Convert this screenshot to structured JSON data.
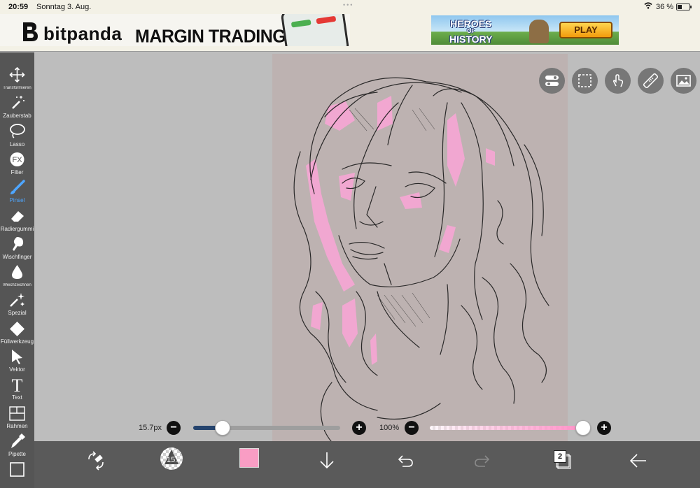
{
  "status_bar": {
    "time": "20:59",
    "date": "Sonntag 3. Aug.",
    "battery": "36 %",
    "battery_level": 0.36
  },
  "ads": {
    "left": {
      "brand": "bitpanda",
      "slogan": "MARGIN TRADING"
    },
    "right": {
      "title_line1": "HEROES",
      "title_of": "OF",
      "title_line2": "HISTORY",
      "button": "PLAY"
    }
  },
  "toolbar": {
    "tools": [
      {
        "label": "Transformieren",
        "icon": "move-icon"
      },
      {
        "label": "Zauberstab",
        "icon": "magic-wand-icon"
      },
      {
        "label": "Lasso",
        "icon": "lasso-icon"
      },
      {
        "label": "Filter",
        "icon": "fx-icon",
        "glyph": "FX"
      },
      {
        "label": "Pinsel",
        "icon": "brush-icon",
        "active": true
      },
      {
        "label": "Radiergummi",
        "icon": "eraser-icon"
      },
      {
        "label": "Wischfinger",
        "icon": "smudge-icon"
      },
      {
        "label": "Weichzeichnen",
        "icon": "blur-drop-icon"
      },
      {
        "label": "Spezial",
        "icon": "sparkle-icon"
      },
      {
        "label": "Füllwerkzeug",
        "icon": "fill-bucket-icon"
      },
      {
        "label": "Vektor",
        "icon": "vector-arrow-icon"
      },
      {
        "label": "Text",
        "icon": "text-icon",
        "glyph": "T"
      },
      {
        "label": "Rahmen",
        "icon": "frame-icon"
      },
      {
        "label": "Pipette",
        "icon": "eyedropper-icon"
      }
    ]
  },
  "canvas_buttons": [
    "toggle-icon",
    "selection-icon",
    "touch-icon",
    "ruler-icon",
    "image-icon"
  ],
  "brush": {
    "size_label": "15.7px",
    "size_fraction": 0.2,
    "opacity_label": "100%",
    "opacity_fraction": 1.0,
    "preview_size": "15.7"
  },
  "bottom_bar": {
    "color": "#f99dc4",
    "layer_count": "2"
  }
}
